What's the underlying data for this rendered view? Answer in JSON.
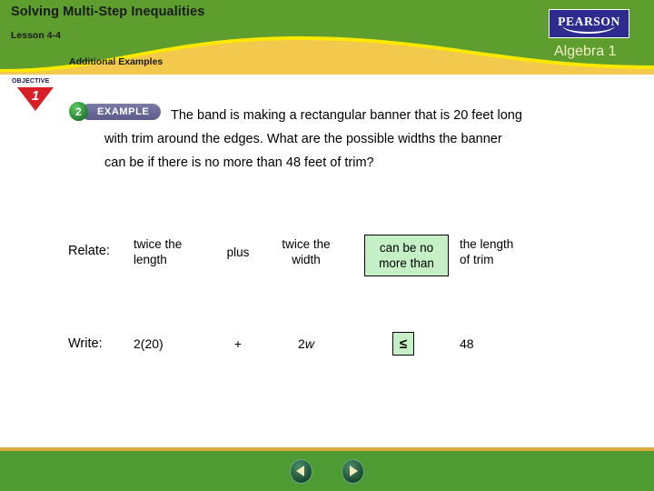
{
  "header": {
    "title": "Solving Multi-Step Inequalities",
    "lesson": "Lesson 4-4",
    "section": "Additional Examples",
    "brand": "PEARSON",
    "course": "Algebra 1",
    "green": "#5d9e2e",
    "gold": "#f2c94c",
    "yellow_edge": "#ffe800",
    "brand_blue": "#2e2b8f",
    "course_color": "#f7edc9"
  },
  "objective": {
    "word": "OBJECTIVE",
    "number": "1",
    "triangle_color": "#d81f26"
  },
  "example": {
    "number": "2",
    "label": "EXAMPLE",
    "circle_color": "#2e9a3c",
    "pill_color": "#5b5b8c"
  },
  "problem": {
    "line1": "The band is making a rectangular banner that is 20 feet long",
    "line2": "with trim around the edges. What are the possible widths the banner",
    "line3": "can be if there is no more than 48 feet of trim?"
  },
  "table": {
    "relate_label": "Relate:",
    "write_label": "Write:",
    "highlight_color": "#c5f0c5",
    "relate": {
      "twice_length_l1": "twice the",
      "twice_length_l2": "length",
      "plus": "plus",
      "twice_width_l1": "twice the",
      "twice_width_l2": "width",
      "can_be_l1": "can be no",
      "can_be_l2": "more than",
      "length_trim_l1": "the length",
      "length_trim_l2": "of trim"
    },
    "write": {
      "expr1": "2(20)",
      "plus": "+",
      "expr2_coeff": "2",
      "expr2_var": "w",
      "inequality": "≤",
      "value": "48"
    }
  },
  "footer": {
    "bar_color": "#4e9b33",
    "border_color": "#d8ad3e",
    "back_label": "Back",
    "next_label": "Next"
  }
}
